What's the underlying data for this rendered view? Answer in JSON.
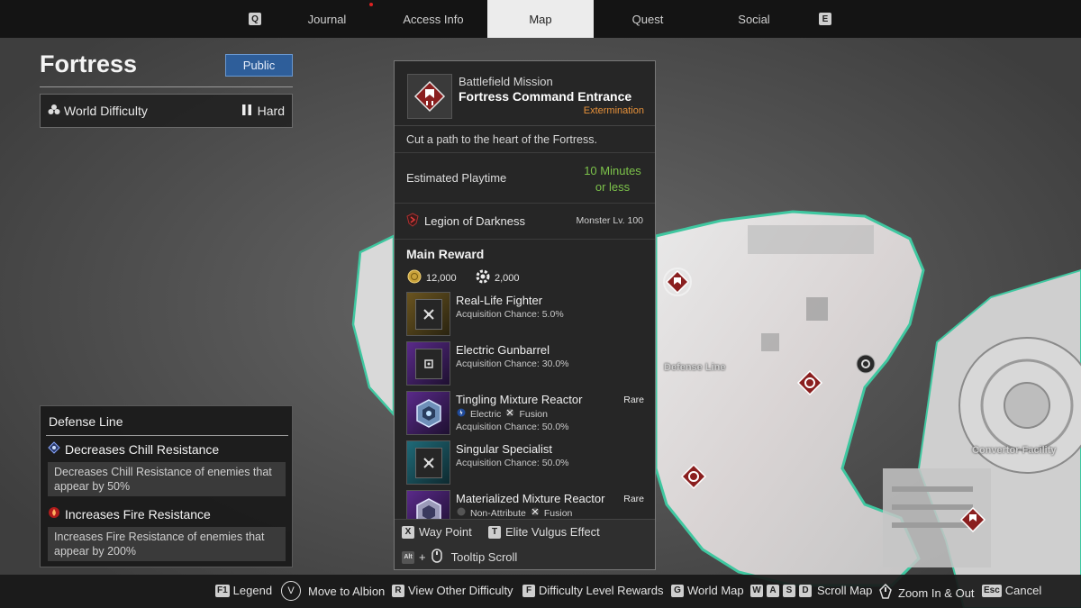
{
  "nav": {
    "left_key": "Q",
    "tabs": [
      {
        "label": "Journal"
      },
      {
        "label": "Access Info"
      },
      {
        "label": "Map"
      },
      {
        "label": "Quest"
      },
      {
        "label": "Social"
      }
    ],
    "right_key": "E"
  },
  "left_panel": {
    "title": "Fortress",
    "public_label": "Public",
    "world_difficulty_label": "World Difficulty",
    "world_difficulty_value": "Hard",
    "defense": {
      "title": "Defense Line",
      "effects": [
        {
          "name": "Decreases Chill Resistance",
          "desc": "Decreases Chill Resistance of enemies that appear by 50%",
          "icon": "chill-icon"
        },
        {
          "name": "Increases Fire Resistance",
          "desc": "Increases Fire Resistance of enemies that appear by 200%",
          "icon": "fire-icon"
        }
      ]
    }
  },
  "mission": {
    "type": "Battlefield Mission",
    "name": "Fortress Command Entrance",
    "subtype": "Extermination",
    "description": "Cut a path to the heart of the Fortress.",
    "playtime_label": "Estimated Playtime",
    "playtime_value": "10 Minutes or less",
    "faction": "Legion of Darkness",
    "monster_level": "Monster Lv. 100",
    "main_reward_label": "Main Reward",
    "gold": "12,000",
    "exp": "2,000",
    "rewards": [
      {
        "name": "Real-Life Fighter",
        "chance": "Acquisition Chance: 5.0%",
        "rare": "",
        "tags": [],
        "color": "#b08a2a"
      },
      {
        "name": "Electric Gunbarrel",
        "chance": "Acquisition Chance: 30.0%",
        "rare": "",
        "tags": [],
        "color": "#7a3fb0"
      },
      {
        "name": "Tingling Mixture Reactor",
        "chance": "Acquisition Chance: 50.0%",
        "rare": "Rare",
        "tags": [
          "Electric",
          "Fusion"
        ],
        "color": "#7a3fb0"
      },
      {
        "name": "Singular Specialist",
        "chance": "Acquisition Chance: 50.0%",
        "rare": "",
        "tags": [],
        "color": "#2f8a9a"
      },
      {
        "name": "Materialized Mixture Reactor",
        "chance": "",
        "rare": "Rare",
        "tags": [
          "Non-Attribute",
          "Fusion"
        ],
        "color": "#7a3fb0"
      }
    ],
    "footer": {
      "waypoint_key": "X",
      "waypoint_label": "Way Point",
      "vulgus_key": "T",
      "vulgus_label": "Elite Vulgus Effect",
      "scroll_key": "Alt",
      "scroll_plus": "+",
      "scroll_label": "Tooltip Scroll"
    }
  },
  "map_labels": {
    "defense_line": "Defense Line",
    "convertor": "Convertor Facility"
  },
  "bottom_bar": [
    {
      "key": "F1",
      "label": "Legend"
    },
    {
      "key": "V",
      "label": "Move to Albion"
    },
    {
      "key": "R",
      "label": "View Other Difficulty"
    },
    {
      "key": "F",
      "label": "Difficulty Level Rewards"
    },
    {
      "key": "G",
      "label": "World Map"
    },
    {
      "keys": [
        "W",
        "A",
        "S",
        "D"
      ],
      "label": "Scroll Map"
    },
    {
      "key": "",
      "label": "Zoom In & Out"
    },
    {
      "key": "Esc",
      "label": "Cancel"
    }
  ],
  "colors": {
    "accent_orange": "#e8923a",
    "playtime_green": "#7cc24a",
    "public_blue": "#2e5e9a",
    "boundary_teal": "#3fc7a0"
  }
}
